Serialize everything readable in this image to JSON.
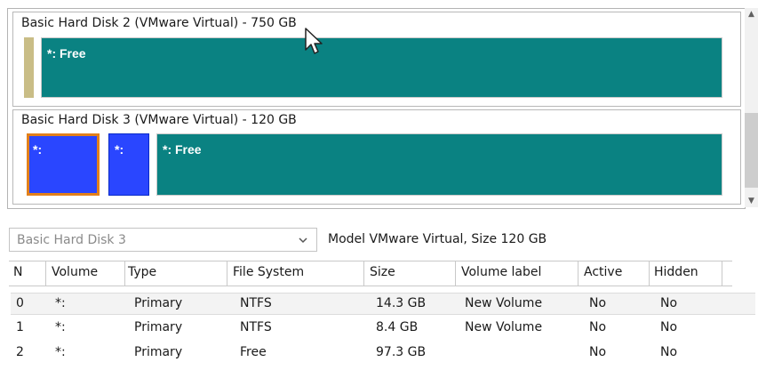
{
  "disk_map": {
    "disks": [
      {
        "title": "Basic Hard Disk 2 (VMware Virtual) - 750 GB",
        "partitions": [
          {
            "label": "",
            "kind": "tan"
          },
          {
            "label": "*: Free",
            "kind": "free"
          }
        ]
      },
      {
        "title": "Basic Hard Disk 3 (VMware Virtual) - 120 GB",
        "partitions": [
          {
            "label": "*:",
            "kind": "blue",
            "selected": true
          },
          {
            "label": "*:",
            "kind": "blue"
          },
          {
            "label": "*: Free",
            "kind": "free"
          }
        ]
      }
    ]
  },
  "selector": {
    "disk": "Basic Hard Disk 3",
    "model_info": "Model VMware Virtual, Size 120 GB"
  },
  "table": {
    "columns": [
      "N",
      "Volume",
      "Type",
      "File System",
      "Size",
      "Volume label",
      "Active",
      "Hidden"
    ],
    "rows": [
      {
        "n": "0",
        "volume": "*:",
        "type": "Primary",
        "fs": "NTFS",
        "size": "14.3 GB",
        "label": "New Volume",
        "active": "No",
        "hidden": "No"
      },
      {
        "n": "1",
        "volume": "*:",
        "type": "Primary",
        "fs": "NTFS",
        "size": "8.4 GB",
        "label": "New Volume",
        "active": "No",
        "hidden": "No"
      },
      {
        "n": "2",
        "volume": "*:",
        "type": "Primary",
        "fs": "Free",
        "size": "97.3 GB",
        "label": "",
        "active": "No",
        "hidden": "No"
      }
    ]
  },
  "colors": {
    "free_partition": "#0a8282",
    "primary_partition": "#2a46ff",
    "selection_outline": "#e2801b",
    "reserved_partition": "#c9bd86"
  },
  "icons": {
    "combo": "chevron-down-icon",
    "pointer": "mouse-pointer-icon"
  }
}
